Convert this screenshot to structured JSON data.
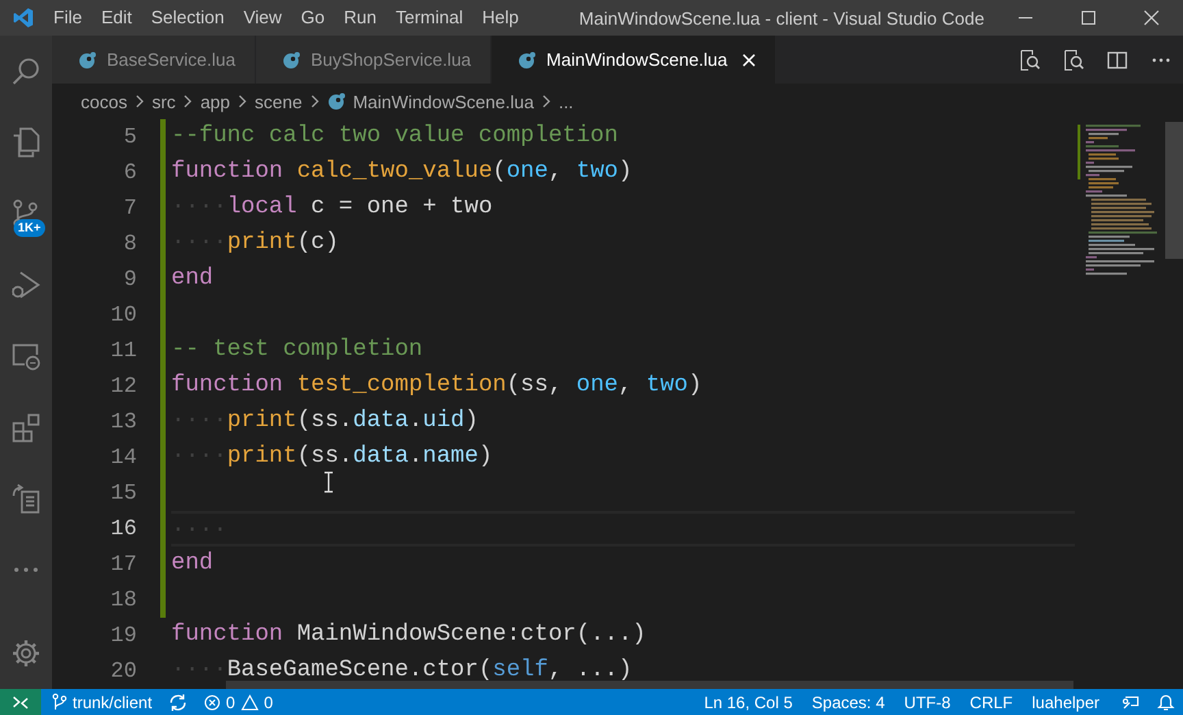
{
  "window": {
    "title": "MainWindowScene.lua - client - Visual Studio Code"
  },
  "menu": [
    "File",
    "Edit",
    "Selection",
    "View",
    "Go",
    "Run",
    "Terminal",
    "Help"
  ],
  "activity_bar": {
    "source_control_badge": "1K+"
  },
  "tabs": [
    {
      "label": "BaseService.lua",
      "selected": false
    },
    {
      "label": "BuyShopService.lua",
      "selected": false
    },
    {
      "label": "MainWindowScene.lua",
      "selected": true
    }
  ],
  "breadcrumb": [
    "cocos",
    "src",
    "app",
    "scene",
    "MainWindowScene.lua",
    "..."
  ],
  "editor": {
    "lines": [
      {
        "number": "5",
        "modified": true,
        "current": false,
        "tokens": [
          {
            "text": "--func calc two value completion",
            "kind": "comment"
          }
        ]
      },
      {
        "number": "6",
        "modified": true,
        "current": false,
        "tokens": [
          {
            "text": "function ",
            "kind": "keyword"
          },
          {
            "text": "calc_two_value",
            "kind": "function"
          },
          {
            "text": "(",
            "kind": "plain"
          },
          {
            "text": "one",
            "kind": "param"
          },
          {
            "text": ", ",
            "kind": "plain"
          },
          {
            "text": "two",
            "kind": "param"
          },
          {
            "text": ")",
            "kind": "plain"
          }
        ]
      },
      {
        "number": "7",
        "modified": true,
        "current": false,
        "tokens": [
          {
            "text": "····",
            "kind": "whitespace"
          },
          {
            "text": "local",
            "kind": "keyword"
          },
          {
            "text": " c = one + two",
            "kind": "plain"
          }
        ]
      },
      {
        "number": "8",
        "modified": true,
        "current": false,
        "tokens": [
          {
            "text": "····",
            "kind": "whitespace"
          },
          {
            "text": "print",
            "kind": "function"
          },
          {
            "text": "(c)",
            "kind": "plain"
          }
        ]
      },
      {
        "number": "9",
        "modified": true,
        "current": false,
        "tokens": [
          {
            "text": "end",
            "kind": "keyword"
          }
        ]
      },
      {
        "number": "10",
        "modified": true,
        "current": false
      },
      {
        "number": "11",
        "modified": true,
        "current": false,
        "tokens": [
          {
            "text": "-- test completion",
            "kind": "comment"
          }
        ]
      },
      {
        "number": "12",
        "modified": true,
        "current": false,
        "tokens": [
          {
            "text": "function ",
            "kind": "keyword"
          },
          {
            "text": "test_completion",
            "kind": "function"
          },
          {
            "text": "(ss, ",
            "kind": "plain"
          },
          {
            "text": "one",
            "kind": "param"
          },
          {
            "text": ", ",
            "kind": "plain"
          },
          {
            "text": "two",
            "kind": "param"
          },
          {
            "text": ")",
            "kind": "plain"
          }
        ]
      },
      {
        "number": "13",
        "modified": true,
        "current": false,
        "tokens": [
          {
            "text": "····",
            "kind": "whitespace"
          },
          {
            "text": "print",
            "kind": "function"
          },
          {
            "text": "(ss.",
            "kind": "plain"
          },
          {
            "text": "data",
            "kind": "field"
          },
          {
            "text": ".",
            "kind": "plain"
          },
          {
            "text": "uid",
            "kind": "field"
          },
          {
            "text": ")",
            "kind": "plain"
          }
        ]
      },
      {
        "number": "14",
        "modified": true,
        "current": false,
        "tokens": [
          {
            "text": "····",
            "kind": "whitespace"
          },
          {
            "text": "print",
            "kind": "function"
          },
          {
            "text": "(ss.",
            "kind": "plain"
          },
          {
            "text": "data",
            "kind": "field"
          },
          {
            "text": ".",
            "kind": "plain"
          },
          {
            "text": "name",
            "kind": "field"
          },
          {
            "text": ")",
            "kind": "plain"
          }
        ]
      },
      {
        "number": "15",
        "modified": true,
        "current": false
      },
      {
        "number": "16",
        "modified": true,
        "current": true,
        "tokens": [
          {
            "text": "····",
            "kind": "whitespace"
          }
        ]
      },
      {
        "number": "17",
        "modified": true,
        "current": false,
        "tokens": [
          {
            "text": "end",
            "kind": "keyword"
          }
        ]
      },
      {
        "number": "18",
        "modified": true,
        "current": false
      },
      {
        "number": "19",
        "modified": false,
        "current": false,
        "tokens": [
          {
            "text": "function ",
            "kind": "keyword"
          },
          {
            "text": "MainWindowScene:ctor(...)",
            "kind": "plain"
          }
        ]
      },
      {
        "number": "20",
        "modified": false,
        "current": false,
        "tokens": [
          {
            "text": "····",
            "kind": "whitespace"
          },
          {
            "text": "BaseGameScene.ctor(",
            "kind": "plain"
          },
          {
            "text": "self",
            "kind": "self"
          },
          {
            "text": ", ...)",
            "kind": "plain"
          }
        ]
      }
    ]
  },
  "status_bar": {
    "branch": "trunk/client",
    "errors": "0",
    "warnings": "0",
    "right": [
      "Ln 16, Col 5",
      "Spaces: 4",
      "UTF-8",
      "CRLF",
      "luahelper"
    ]
  }
}
